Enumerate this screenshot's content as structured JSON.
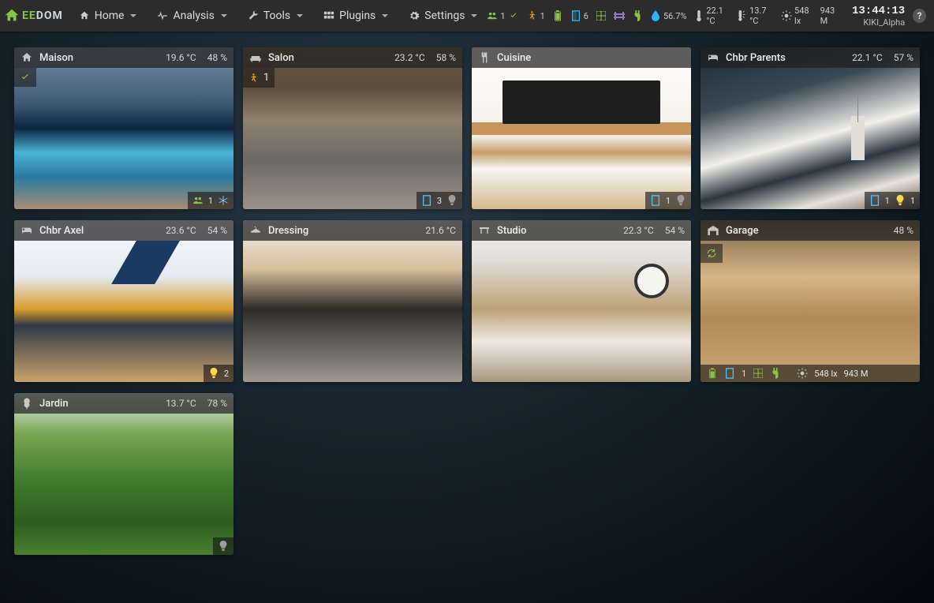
{
  "brand": {
    "ee": "EE",
    "dom": "DOM"
  },
  "menu": {
    "home": "Home",
    "analysis": "Analysis",
    "tools": "Tools",
    "plugins": "Plugins",
    "settings": "Settings"
  },
  "status": {
    "presence": "1",
    "motion": "1",
    "doors": "6",
    "humidity": "56.7%",
    "temp_in": "22.1 °C",
    "temp_out": "13.7 °C",
    "lux": "548 lx",
    "power": "943 M"
  },
  "clock": {
    "time": "13:44:13",
    "user": "KIKI_Alpha"
  },
  "rooms": {
    "maison": {
      "name": "Maison",
      "temp": "19.6 °C",
      "hum": "48 %",
      "presence": "1"
    },
    "salon": {
      "name": "Salon",
      "temp": "23.2 °C",
      "hum": "58 %",
      "motion": "1",
      "doors": "3"
    },
    "cuisine": {
      "name": "Cuisine",
      "doors": "1"
    },
    "parents": {
      "name": "Chbr Parents",
      "temp": "22.1 °C",
      "hum": "57 %",
      "doors": "1",
      "bulb": "1"
    },
    "axel": {
      "name": "Chbr Axel",
      "temp": "23.6 °C",
      "hum": "54 %",
      "bulb": "2"
    },
    "dressing": {
      "name": "Dressing",
      "temp": "21.6 °C"
    },
    "studio": {
      "name": "Studio",
      "temp": "22.3 °C",
      "hum": "54 %"
    },
    "garage": {
      "name": "Garage",
      "hum": "48 %",
      "doors": "1",
      "lux": "548 lx",
      "power": "943 M"
    },
    "jardin": {
      "name": "Jardin",
      "temp": "13.7 °C",
      "hum": "78 %"
    }
  }
}
